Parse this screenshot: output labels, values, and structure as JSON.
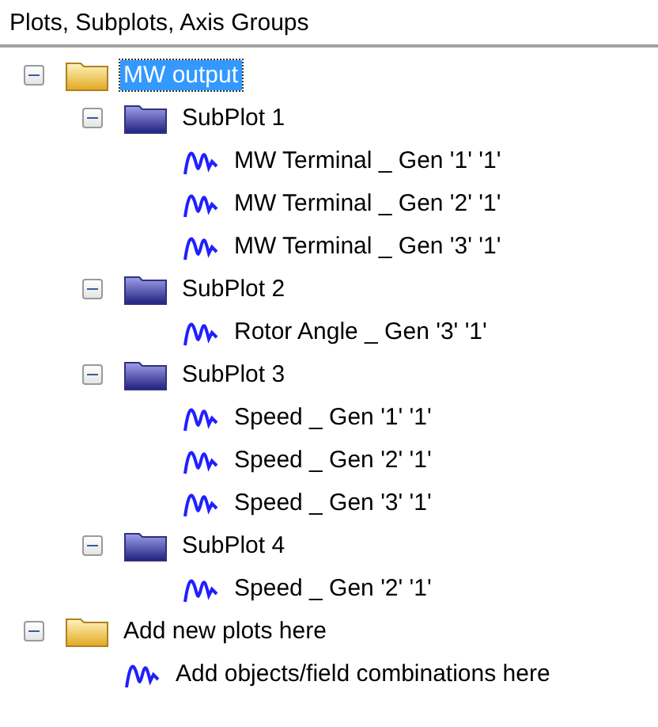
{
  "header": {
    "title": "Plots, Subplots, Axis Groups"
  },
  "tree": [
    {
      "kind": "plot",
      "label": "MW output",
      "expanded": true,
      "selected": true,
      "children": [
        {
          "kind": "subplot",
          "label": "SubPlot 1",
          "expanded": true,
          "selected": false,
          "children": [
            {
              "kind": "signal",
              "label": "MW Terminal _ Gen '1' '1'",
              "selected": false
            },
            {
              "kind": "signal",
              "label": "MW Terminal _ Gen '2' '1'",
              "selected": false
            },
            {
              "kind": "signal",
              "label": "MW Terminal _ Gen '3' '1'",
              "selected": false
            }
          ]
        },
        {
          "kind": "subplot",
          "label": "SubPlot 2",
          "expanded": true,
          "selected": false,
          "children": [
            {
              "kind": "signal",
              "label": "Rotor Angle _ Gen '3' '1'",
              "selected": false
            }
          ]
        },
        {
          "kind": "subplot",
          "label": "SubPlot 3",
          "expanded": true,
          "selected": false,
          "children": [
            {
              "kind": "signal",
              "label": "Speed _ Gen '1' '1'",
              "selected": false
            },
            {
              "kind": "signal",
              "label": "Speed _ Gen '2' '1'",
              "selected": false
            },
            {
              "kind": "signal",
              "label": "Speed _ Gen '3' '1'",
              "selected": false
            }
          ]
        },
        {
          "kind": "subplot",
          "label": "SubPlot 4",
          "expanded": true,
          "selected": false,
          "children": [
            {
              "kind": "signal",
              "label": "Speed _ Gen '2' '1'",
              "selected": false
            }
          ]
        }
      ]
    },
    {
      "kind": "plot",
      "label": "Add new plots here",
      "expanded": true,
      "selected": false,
      "children": [
        {
          "kind": "signal",
          "label": "Add objects/field combinations here",
          "selected": false
        }
      ]
    }
  ]
}
